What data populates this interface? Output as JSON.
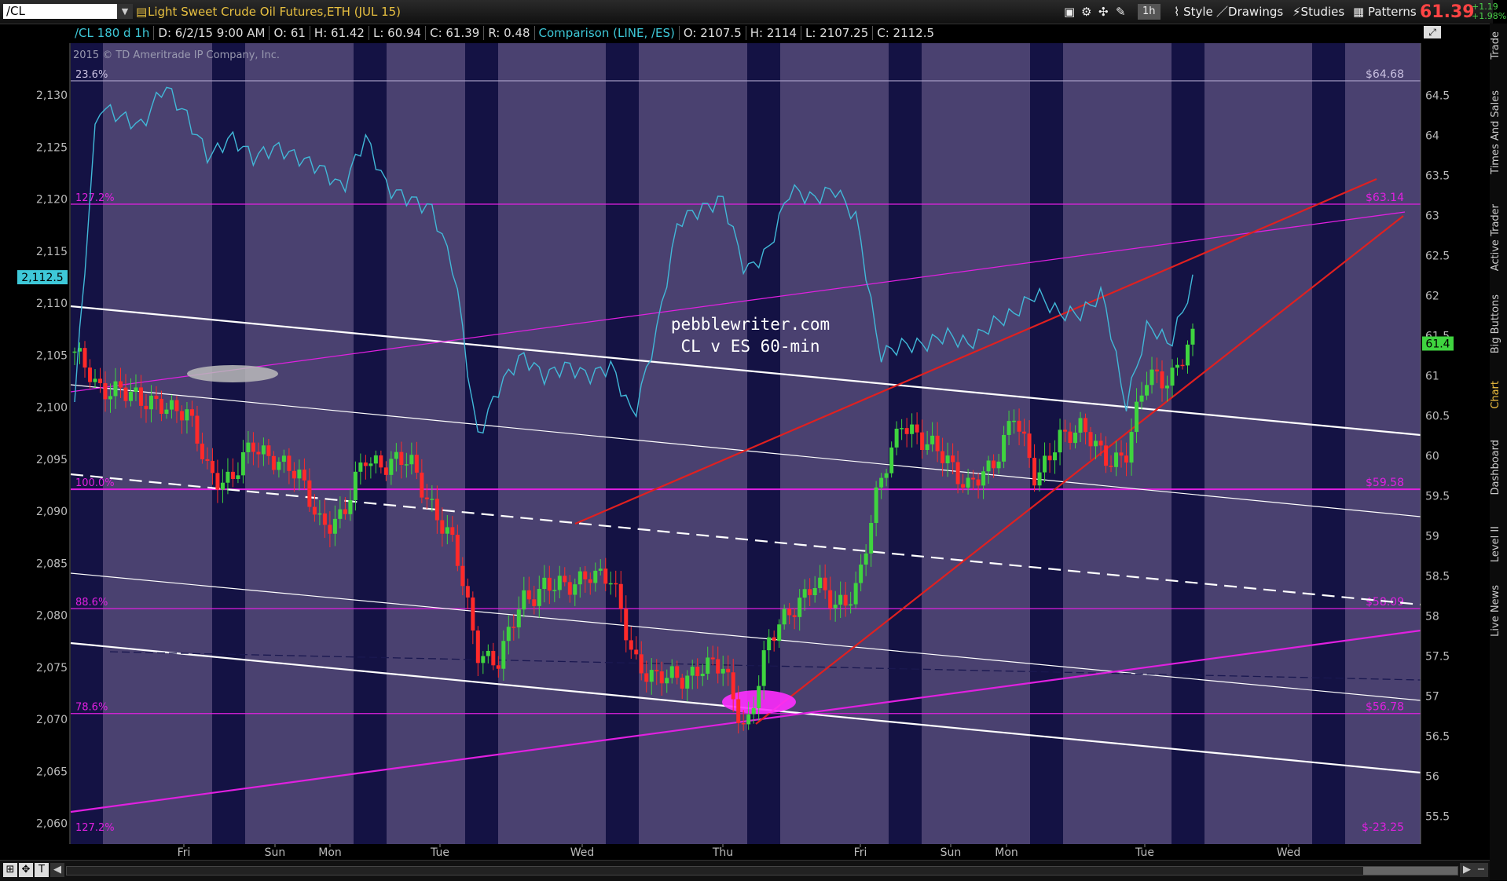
{
  "header": {
    "symbol": "/CL",
    "instrument_name": "Light Sweet Crude Oil Futures,ETH (JUL 15)",
    "timeframe": "1h",
    "style_label": "Style",
    "drawings_label": "Drawings",
    "studies_label": "Studies",
    "patterns_label": "Patterns",
    "last_price": "61.39",
    "change": "+1.19",
    "change_pct": "+1.98%"
  },
  "infobar": {
    "series": "/CL 180 d 1h",
    "date": "D: 6/2/15 9:00 AM",
    "open": "O: 61",
    "high": "H: 61.42",
    "low": "L: 60.94",
    "close": "C: 61.39",
    "range": "R: 0.48",
    "comparison": "Comparison (LINE, /ES)",
    "cmp_open": "O: 2107.5",
    "cmp_high": "H: 2114",
    "cmp_low": "L: 2107.25",
    "cmp_close": "C: 2112.5"
  },
  "sidebar": {
    "tabs": [
      "Trade",
      "Times And Sales",
      "Active Trader",
      "Big Buttons",
      "Chart",
      "Dashboard",
      "Level II",
      "Live News"
    ]
  },
  "colors": {
    "background": "#4a4170",
    "night_band": "#0a0a3c",
    "candle_up": "#3fd43f",
    "candle_down": "#ff2a2a",
    "comparison_line": "#41b8d8",
    "fib_line": "#e020e0",
    "trend_red": "#e02020",
    "channel_white": "#ffffff"
  },
  "chart_data": {
    "type": "line",
    "title": "",
    "watermark": "2015 © TD Ameritrade IP Company, Inc.",
    "annotation": [
      "pebblewriter.com",
      "CL v ES 60-min"
    ],
    "left_axis": {
      "ticks": [
        "2,130",
        "2,125",
        "2,120",
        "2,115",
        "2,110",
        "2,105",
        "2,100",
        "2,095",
        "2,090",
        "2,085",
        "2,080",
        "2,075",
        "2,070",
        "2,065",
        "2,060"
      ],
      "range": [
        2058,
        2135
      ],
      "marker": "2,112.5"
    },
    "right_axis": {
      "ticks": [
        "64.5",
        "64",
        "63.5",
        "63",
        "62.5",
        "62",
        "61.5",
        "61",
        "60.5",
        "60",
        "59.5",
        "59",
        "58.5",
        "58",
        "57.5",
        "57",
        "56.5",
        "56",
        "55.5"
      ],
      "range": [
        55.15,
        65.15
      ],
      "marker": "61.4"
    },
    "x_labels": [
      "Fri",
      "Sun",
      "Mon",
      "Tue",
      "Wed",
      "Thu",
      "Fri",
      "Sun",
      "Mon",
      "Tue",
      "Wed"
    ],
    "fib_levels": [
      {
        "pct": "23.6%",
        "price": "$64.68",
        "value": 64.68
      },
      {
        "pct": "127.2%",
        "price": "$63.14",
        "value": 63.14
      },
      {
        "pct": "100.0%",
        "price": "$59.58",
        "value": 59.58
      },
      {
        "pct": "88.6%",
        "price": "$58.09",
        "value": 58.09
      },
      {
        "pct": "78.6%",
        "price": "$56.78",
        "value": 56.78
      },
      {
        "pct": "127.2%",
        "price": "$-23.25",
        "value": null
      }
    ],
    "anchors": [
      {
        "c": 61.3,
        "b": 2100.5
      },
      {
        "c": 60.8,
        "b": 2129
      },
      {
        "c": 60.9,
        "b": 2128
      },
      {
        "c": 60.6,
        "b": 2127
      },
      {
        "c": 60.7,
        "b": 2131
      },
      {
        "c": 60.5,
        "b": 2128
      },
      {
        "c": 59.8,
        "b": 2124
      },
      {
        "c": 59.7,
        "b": 2126
      },
      {
        "c": 60.1,
        "b": 2124
      },
      {
        "c": 60.0,
        "b": 2125
      },
      {
        "c": 59.7,
        "b": 2124
      },
      {
        "c": 59.2,
        "b": 2123
      },
      {
        "c": 59.2,
        "b": 2121
      },
      {
        "c": 60.0,
        "b": 2126
      },
      {
        "c": 59.9,
        "b": 2121
      },
      {
        "c": 59.9,
        "b": 2120
      },
      {
        "c": 59.4,
        "b": 2119
      },
      {
        "c": 58.8,
        "b": 2113
      },
      {
        "c": 57.6,
        "b": 2097
      },
      {
        "c": 57.4,
        "b": 2102
      },
      {
        "c": 58.2,
        "b": 2105
      },
      {
        "c": 58.4,
        "b": 2103
      },
      {
        "c": 58.3,
        "b": 2104
      },
      {
        "c": 58.6,
        "b": 2103
      },
      {
        "c": 58.4,
        "b": 2104
      },
      {
        "c": 57.5,
        "b": 2099
      },
      {
        "c": 57.2,
        "b": 2107
      },
      {
        "c": 57.2,
        "b": 2118
      },
      {
        "c": 57.4,
        "b": 2119
      },
      {
        "c": 57.3,
        "b": 2120
      },
      {
        "c": 56.6,
        "b": 2113
      },
      {
        "c": 57.6,
        "b": 2115
      },
      {
        "c": 58.1,
        "b": 2121
      },
      {
        "c": 58.4,
        "b": 2120
      },
      {
        "c": 58.1,
        "b": 2121
      },
      {
        "c": 58.4,
        "b": 2118
      },
      {
        "c": 59.6,
        "b": 2105
      },
      {
        "c": 60.5,
        "b": 2106
      },
      {
        "c": 60.1,
        "b": 2106
      },
      {
        "c": 60.0,
        "b": 2107
      },
      {
        "c": 59.6,
        "b": 2106
      },
      {
        "c": 59.8,
        "b": 2108
      },
      {
        "c": 60.6,
        "b": 2109
      },
      {
        "c": 59.6,
        "b": 2111
      },
      {
        "c": 60.3,
        "b": 2109
      },
      {
        "c": 60.3,
        "b": 2109
      },
      {
        "c": 60.0,
        "b": 2111
      },
      {
        "c": 60.0,
        "b": 2100
      },
      {
        "c": 61.0,
        "b": 2108
      },
      {
        "c": 61.0,
        "b": 2106
      },
      {
        "c": 61.4,
        "b": 2112
      }
    ]
  }
}
